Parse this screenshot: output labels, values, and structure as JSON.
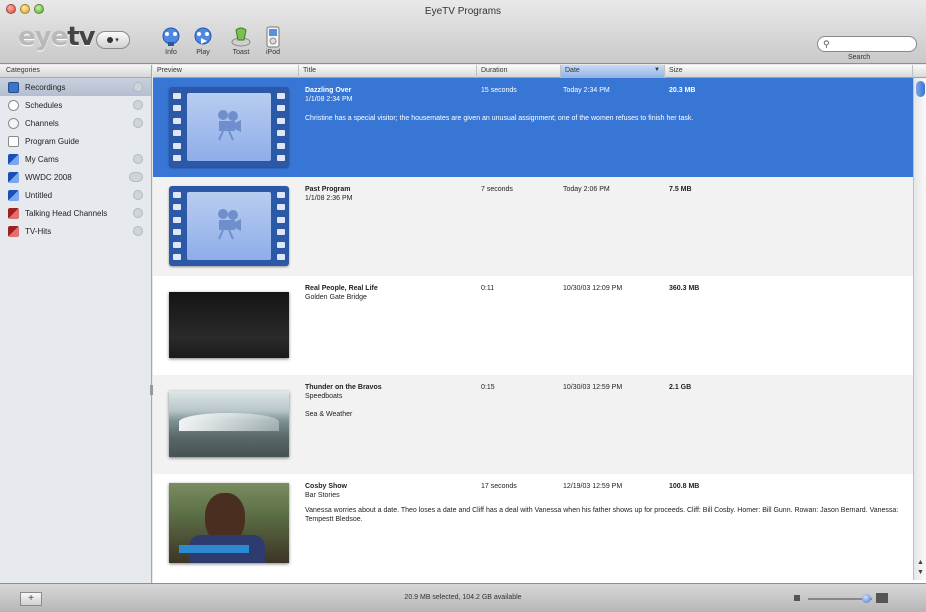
{
  "window": {
    "title": "EyeTV Programs"
  },
  "logo": {
    "eye": "eye",
    "tv": "tv"
  },
  "toolbar": {
    "tools": [
      {
        "label": "Info",
        "icon": "info-icon"
      },
      {
        "label": "Play",
        "icon": "play-icon"
      },
      {
        "label": "Toast",
        "icon": "toast-icon"
      },
      {
        "label": "iPod",
        "icon": "ipod-icon"
      }
    ],
    "search_label": "Search",
    "search_placeholder": ""
  },
  "sidebar": {
    "header": "Categories",
    "items": [
      {
        "label": "Recordings",
        "icon": "recordings-icon",
        "selected": true
      },
      {
        "label": "Schedules",
        "icon": "schedules-icon"
      },
      {
        "label": "Channels",
        "icon": "channels-icon"
      },
      {
        "label": "Program Guide",
        "icon": "program-guide-icon"
      },
      {
        "label": "My Cams",
        "icon": "playlist-icon"
      },
      {
        "label": "WWDC 2008",
        "icon": "playlist-icon"
      },
      {
        "label": "Untitled",
        "icon": "playlist-icon"
      },
      {
        "label": "Talking Head Channels",
        "icon": "smart-playlist-icon"
      },
      {
        "label": "TV-Hits",
        "icon": "smart-playlist-icon"
      }
    ]
  },
  "list": {
    "columns": {
      "preview": "Preview",
      "title": "Title",
      "duration": "Duration",
      "date": "Date",
      "size": "Size"
    },
    "rows": [
      {
        "title": "Dazzling Over",
        "subtitle": "1/1/08 2:34 PM",
        "duration": "15 seconds",
        "date": "Today 2:34 PM",
        "size": "20.3 MB",
        "desc": "Christine has a special visitor; the housemates are given an unusual assignment; one of the women refuses to finish her task."
      },
      {
        "title": "Past Program",
        "subtitle": "1/1/08 2:36 PM",
        "duration": "7 seconds",
        "date": "Today 2:06 PM",
        "size": "7.5 MB",
        "desc": ""
      },
      {
        "title": "Real People, Real Life",
        "subtitle": "Golden Gate Bridge",
        "duration": "0:11",
        "date": "10/30/03 12:09 PM",
        "size": "360.3 MB",
        "desc": ""
      },
      {
        "title": "Thunder on the Bravos",
        "subtitle": "Speedboats",
        "extra": "Sea & Weather",
        "duration": "0:15",
        "date": "10/30/03 12:59 PM",
        "size": "2.1 GB",
        "desc": ""
      },
      {
        "title": "Cosby Show",
        "subtitle": "Bar Stories",
        "duration": "17 seconds",
        "date": "12/19/03 12:59 PM",
        "size": "100.8 MB",
        "desc": "Vanessa worries about a date. Theo loses a date and Cliff has a deal with Vanessa when his father shows up for proceeds. Cliff: Bill Cosby. Homer: Bill Gunn. Rowan: Jason Bernard. Vanessa: Tempestt Bledsoe."
      }
    ]
  },
  "status": {
    "text": "20.9 MB selected, 104.2 GB available"
  },
  "colors": {
    "selection": "#3876d6",
    "accent": "#3b74c8"
  }
}
